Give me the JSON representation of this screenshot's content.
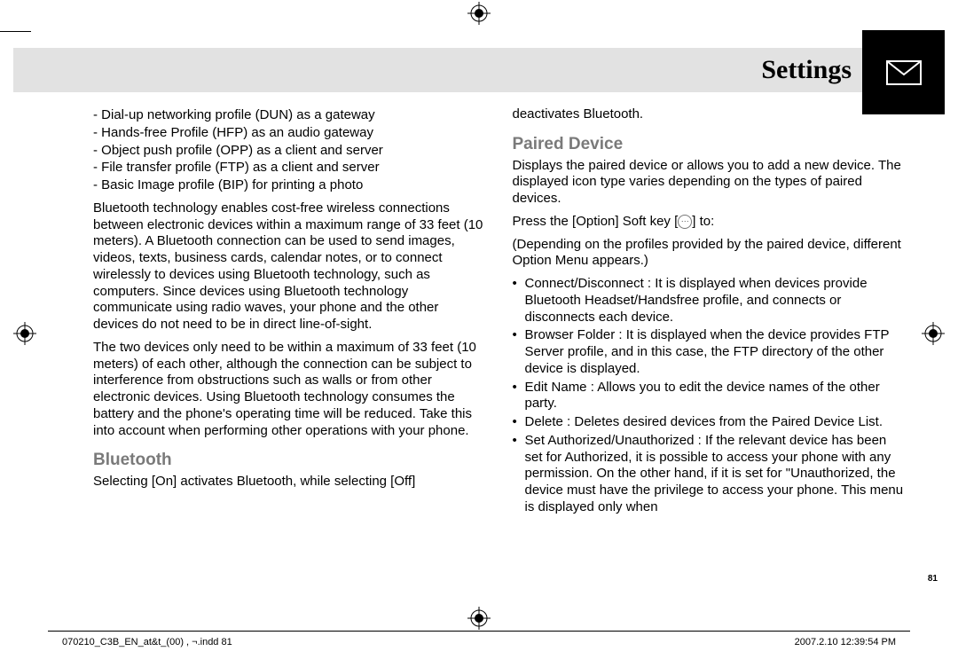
{
  "header": {
    "title": "Settings",
    "icon": "envelope-icon"
  },
  "left_col": {
    "profiles": [
      "- Dial-up networking profile (DUN) as a gateway",
      "- Hands-free Profile (HFP) as an audio gateway",
      "- Object push profile (OPP) as a client and server",
      "- File transfer profile (FTP) as a client and server",
      "- Basic Image profile (BIP) for printing a photo"
    ],
    "para1": "Bluetooth technology enables cost-free wireless connections between electronic devices within a maximum range of 33 feet (10 meters). A Bluetooth connection can be used to send images, videos, texts, business cards, calendar notes, or to connect wirelessly to devices using Bluetooth technology, such as computers. Since devices using Bluetooth technology communicate using radio waves, your phone and the other devices do not need to be in direct line-of-sight.",
    "para2": "The two devices only need to be within a maximum of 33 feet (10 meters) of each other, although the connection can be subject to interference from obstructions such as walls or from other electronic devices. Using Bluetooth technology consumes the battery and the phone's operating time will be reduced. Take this into account when performing other operations with your phone.",
    "bluetooth_head": "Bluetooth",
    "bluetooth_text": "Selecting [On] activates Bluetooth, while selecting [Off]"
  },
  "right_col": {
    "cont": "deactivates Bluetooth.",
    "paired_head": "Paired Device",
    "paired_intro": "Displays the paired device or allows you to add a new device. The displayed icon type varies depending on the types of paired devices.",
    "press_pre": "Press the [Option] Soft key [",
    "press_post": "] to:",
    "depending": "(Depending on the profiles provided by the paired device, different Option Menu appears.)",
    "bullets": [
      "Connect/Disconnect : It is displayed when devices provide Bluetooth Headset/Handsfree profile, and connects or disconnects each device.",
      "Browser Folder : It is displayed when the device provides FTP Server profile, and in this case, the FTP directory of the other device is displayed.",
      "Edit Name : Allows you to edit the device names of the other party.",
      "Delete : Deletes desired devices from the Paired Device List.",
      "Set Authorized/Unauthorized : If the relevant device has been set for Authorized, it is possible to access your phone with any permission. On the other hand, if it is set for \"Unauthorized, the device must have the privilege to access your phone. This menu is displayed only when"
    ]
  },
  "page_number": "81",
  "footer": {
    "left": "070210_C3B_EN_at&t_(00) , ¬.indd   81",
    "right": "2007.2.10   12:39:54 PM"
  }
}
